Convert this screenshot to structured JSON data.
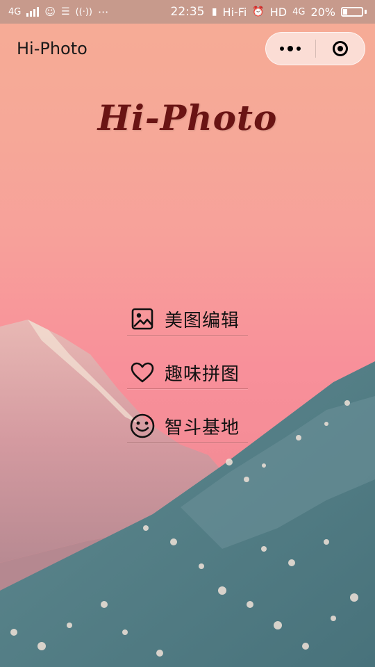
{
  "status_bar": {
    "network": "4G",
    "time": "22:35",
    "wifi_label": "Hi-Fi",
    "hd_label": "HD",
    "network_right": "4G",
    "battery_percent": "20%",
    "battery_level": 0.2,
    "more": "···"
  },
  "navbar": {
    "title": "Hi-Photo",
    "menu_icon": "more-dots-icon",
    "close_icon": "target-circle-icon"
  },
  "logo": {
    "text": "Hi-Photo"
  },
  "menu": {
    "items": [
      {
        "label": "美图编辑",
        "icon": "image-icon"
      },
      {
        "label": "趣味拼图",
        "icon": "heart-icon"
      },
      {
        "label": "智斗基地",
        "icon": "smiley-icon"
      }
    ]
  },
  "colors": {
    "background_top": "#f6ac95",
    "background_bottom": "#f48c96",
    "mountain_front": "#4f7a82",
    "mountain_back": "#d89aa0",
    "logo": "#6a1414"
  }
}
